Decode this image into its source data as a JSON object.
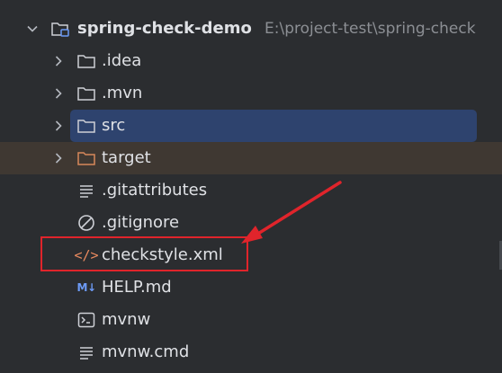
{
  "project": {
    "name": "spring-check-demo",
    "path": "E:\\project-test\\spring-check"
  },
  "items": [
    {
      "label": ".idea",
      "kind": "folder",
      "expandable": true
    },
    {
      "label": ".mvn",
      "kind": "folder",
      "expandable": true
    },
    {
      "label": "src",
      "kind": "folder",
      "expandable": true,
      "selected": true
    },
    {
      "label": "target",
      "kind": "excluded-folder",
      "expandable": true
    },
    {
      "label": ".gitattributes",
      "kind": "text-file",
      "expandable": false
    },
    {
      "label": ".gitignore",
      "kind": "ignore-file",
      "expandable": false
    },
    {
      "label": "checkstyle.xml",
      "kind": "xml-file",
      "expandable": false,
      "highlighted": true
    },
    {
      "label": "HELP.md",
      "kind": "markdown-file",
      "expandable": false,
      "icon_text": "M↓"
    },
    {
      "label": "mvnw",
      "kind": "shell-file",
      "expandable": false
    },
    {
      "label": "mvnw.cmd",
      "kind": "text-file",
      "expandable": false
    }
  ],
  "colors": {
    "background": "#2b2d30",
    "selection": "#2e436e",
    "target_row": "#3f3832",
    "annotation": "#e0242b",
    "excluded_folder": "#d7875a",
    "xml_icon": "#ea8a5f",
    "md_icon": "#6d9bf7"
  }
}
